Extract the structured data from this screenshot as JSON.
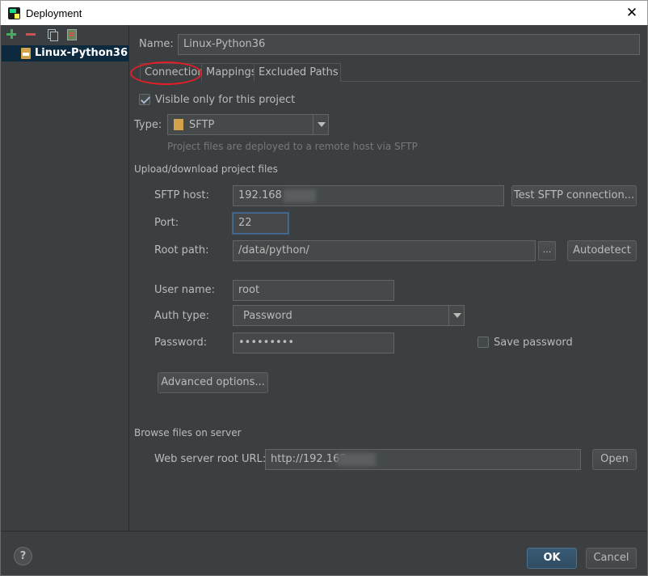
{
  "window": {
    "title": "Deployment",
    "close_glyph": "✕"
  },
  "sidebar": {
    "toolbar": [
      "add-icon",
      "remove-icon",
      "copy-icon",
      "use-as-default-icon"
    ],
    "servers": [
      {
        "label": "Linux-Python36",
        "icon": "sftp-server-icon"
      }
    ]
  },
  "form": {
    "name_label": "Name:",
    "name_value": "Linux-Python36",
    "tabs": [
      {
        "label": "Connection",
        "active": true
      },
      {
        "label": "Mappings"
      },
      {
        "label": "Excluded Paths"
      }
    ],
    "visible_only_label": "Visible only for this project",
    "visible_only_checked": true,
    "type_label": "Type:",
    "type_value": "SFTP",
    "type_hint": "Project files are deployed to a remote host via SFTP",
    "upload_section": "Upload/download project files",
    "sftp_host_label": "SFTP host:",
    "sftp_host_value": "192.168",
    "test_button": "Test SFTP connection...",
    "port_label": "Port:",
    "port_value": "22",
    "root_path_label": "Root path:",
    "root_path_value": "/data/python/",
    "browse_button": "...",
    "autodetect_button": "Autodetect",
    "username_label": "User name:",
    "username_value": "root",
    "auth_type_label": "Auth type:",
    "auth_type_value": "Password",
    "password_label": "Password:",
    "password_value": "•••••••••",
    "save_password_label": "Save password",
    "save_password_checked": false,
    "advanced_button": "Advanced options...",
    "browse_section": "Browse files on server",
    "web_root_label": "Web server root URL:",
    "web_root_value": "http://192.168",
    "open_button": "Open"
  },
  "footer": {
    "help_glyph": "?",
    "ok_button": "OK",
    "cancel_button": "Cancel"
  },
  "colors": {
    "background": "#3c3f41",
    "field": "#45494a",
    "selection": "#0d293e",
    "annotation_circle": "#e21e27"
  }
}
